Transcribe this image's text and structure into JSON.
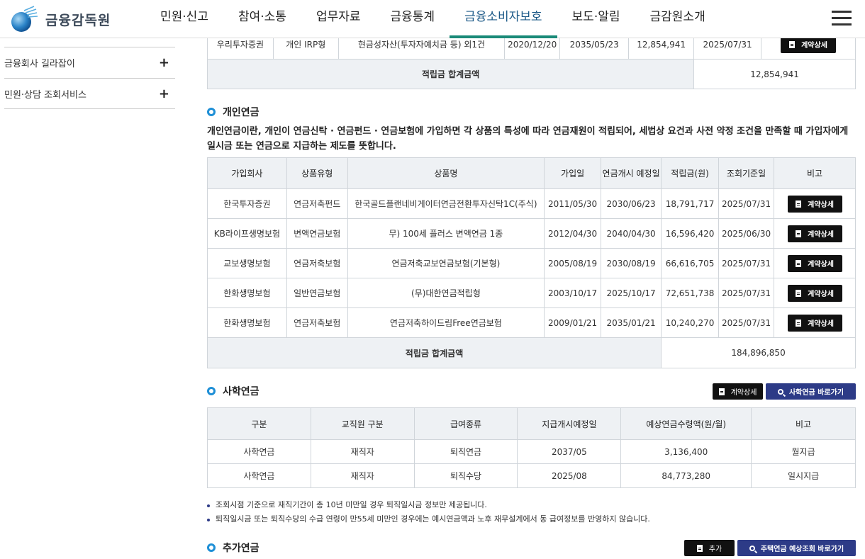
{
  "header": {
    "logo_text": "금융감독원",
    "nav": [
      "민원·신고",
      "참여·소통",
      "업무자료",
      "금융통계",
      "금융소비자보호",
      "보도·알림",
      "금감원소개"
    ]
  },
  "sidebar": {
    "items": [
      {
        "label": "금융회사 길라잡이",
        "icon": "+"
      },
      {
        "label": "민원·상담 조회서비스",
        "icon": "+"
      }
    ]
  },
  "retirement_top": {
    "row": [
      "우리투자증권",
      "개인 IRP형",
      "현금성자산(투자자예치금 등) 외1건",
      "2020/12/20",
      "2035/05/23",
      "12,854,941",
      "2025/07/31"
    ],
    "detail_label": "계약상세",
    "total_label": "적립금 합계금액",
    "total_value": "12,854,941"
  },
  "personal_pension": {
    "title": "개인연금",
    "description": "개인연금이란, 개인이 연금신탁 · 연금펀드 · 연금보험에 가입하면 각 상품의 특성에 따라 연금재원이 적립되어, 세법상 요건과 사전 약정 조건을 만족할 때 가입자에게 일시금 또는 연금으로 지급하는 제도를 뜻합니다.",
    "columns": [
      "가입회사",
      "상품유형",
      "상품명",
      "가입일",
      "연금개시 예정일",
      "적립금(원)",
      "조회기준일",
      "비고"
    ],
    "rows": [
      [
        "한국투자증권",
        "연금저축펀드",
        "한국골드플랜네비게이터연금전환투자신탁1C(주식)",
        "2011/05/30",
        "2030/06/23",
        "18,791,717",
        "2025/07/31"
      ],
      [
        "KB라이프생명보험",
        "변액연금보험",
        "무) 100세 플러스 변액연금 1종",
        "2012/04/30",
        "2040/04/30",
        "16,596,420",
        "2025/06/30"
      ],
      [
        "교보생명보험",
        "연금저축보험",
        "연금저축교보연금보험(기본형)",
        "2005/08/19",
        "2030/08/19",
        "66,616,705",
        "2025/07/31"
      ],
      [
        "한화생명보험",
        "일반연금보험",
        "(무)대한연금적립형",
        "2003/10/17",
        "2025/10/17",
        "72,651,738",
        "2025/07/31"
      ],
      [
        "한화생명보험",
        "연금저축보험",
        "연금저축하이드림Free연금보험",
        "2009/01/21",
        "2035/01/21",
        "10,240,270",
        "2025/07/31"
      ]
    ],
    "detail_label": "계약상세",
    "total_label": "적립금 합계금액",
    "total_value": "184,896,850"
  },
  "teacher_pension": {
    "title": "사학연금",
    "detail_button": "계약상세",
    "goto_button": "사학연금 바로가기",
    "columns": [
      "구분",
      "교직원 구분",
      "급여종류",
      "지급개시예정일",
      "예상연금수령액(원/월)",
      "비고"
    ],
    "rows": [
      [
        "사학연금",
        "재직자",
        "퇴직연금",
        "2037/05",
        "3,136,400",
        "월지급"
      ],
      [
        "사학연금",
        "재직자",
        "퇴직수당",
        "2025/08",
        "84,773,280",
        "일시지급"
      ]
    ],
    "notes": [
      "조회시점 기준으로 재직기간이 총 10년 미만일 경우 퇴직일시금 정보만 제공됩니다.",
      "퇴직일시금 또는 퇴직수당의 수급 연령이 만55세 미만인 경우에는 예시연금액과 노후 재무설계에서 동 급여정보를 반영하지 않습니다."
    ]
  },
  "additional_pension": {
    "title": "추가연금",
    "add_button": "추가",
    "goto_button": "주택연금 예상조회 바로가기"
  }
}
